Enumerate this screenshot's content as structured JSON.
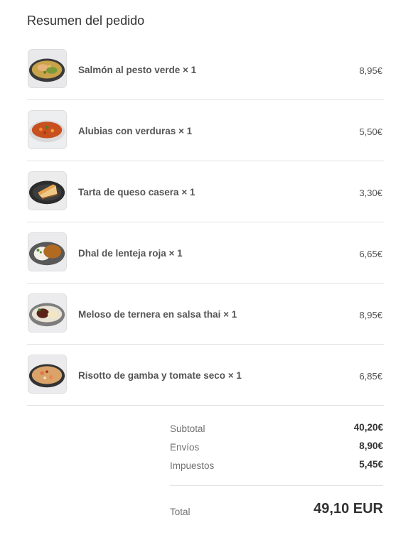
{
  "summary_title": "Resumen del pedido",
  "items": [
    {
      "name": "Salmón al pesto verde × 1",
      "price": "8,95€",
      "image": "salmon-pesto-dish-image"
    },
    {
      "name": "Alubias con verduras × 1",
      "price": "5,50€",
      "image": "beans-vegetables-dish-image"
    },
    {
      "name": "Tarta de queso casera × 1",
      "price": "3,30€",
      "image": "cheesecake-dish-image"
    },
    {
      "name": "Dhal de lenteja roja × 1",
      "price": "6,65€",
      "image": "red-lentil-dhal-dish-image"
    },
    {
      "name": "Meloso de ternera en salsa thai × 1",
      "price": "8,95€",
      "image": "beef-thai-sauce-dish-image"
    },
    {
      "name": "Risotto de gamba y tomate seco × 1",
      "price": "6,85€",
      "image": "shrimp-risotto-dish-image"
    }
  ],
  "totals": {
    "subtotal_label": "Subtotal",
    "subtotal_value": "40,20€",
    "shipping_label": "Envíos",
    "shipping_value": "8,90€",
    "taxes_label": "Impuestos",
    "taxes_value": "5,45€",
    "total_label": "Total",
    "total_value": "49,10 EUR"
  },
  "colors": {
    "text_dark": "#333333",
    "text_item": "#545454",
    "text_muted": "#717171",
    "divider": "#e1e1e1"
  }
}
